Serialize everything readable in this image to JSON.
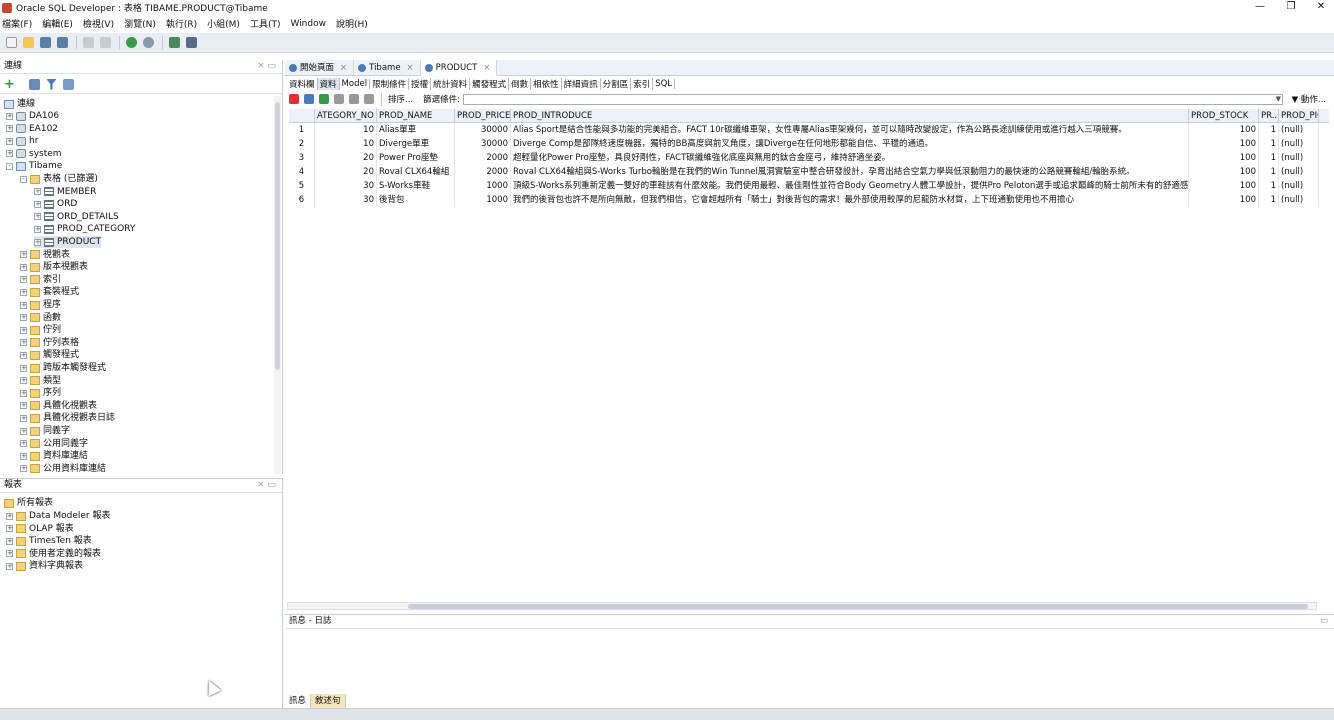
{
  "window": {
    "title": "Oracle SQL Developer : 表格 TIBAME.PRODUCT@Tibame",
    "minimize": "—",
    "maximize": "❐",
    "close": "✕"
  },
  "menu": [
    "檔案(F)",
    "編輯(E)",
    "檢視(V)",
    "瀏覽(N)",
    "執行(R)",
    "小組(M)",
    "工具(T)",
    "Window",
    "說明(H)"
  ],
  "connections": {
    "title": "連線",
    "root": "連線",
    "items": [
      {
        "label": "DA106",
        "level": 1,
        "icon": "db",
        "exp": "+"
      },
      {
        "label": "EA102",
        "level": 1,
        "icon": "db",
        "exp": "+"
      },
      {
        "label": "hr",
        "level": 1,
        "icon": "db",
        "exp": "+"
      },
      {
        "label": "system",
        "level": 1,
        "icon": "db",
        "exp": "+"
      },
      {
        "label": "Tibame",
        "level": 1,
        "icon": "cn",
        "exp": "-"
      },
      {
        "label": "表格 (已篩選)",
        "level": 2,
        "icon": "fld",
        "exp": "-"
      },
      {
        "label": "MEMBER",
        "level": 3,
        "icon": "tbl",
        "exp": "+"
      },
      {
        "label": "ORD",
        "level": 3,
        "icon": "tbl",
        "exp": "+"
      },
      {
        "label": "ORD_DETAILS",
        "level": 3,
        "icon": "tbl",
        "exp": "+"
      },
      {
        "label": "PROD_CATEGORY",
        "level": 3,
        "icon": "tbl",
        "exp": "+"
      },
      {
        "label": "PRODUCT",
        "level": 3,
        "icon": "tbl",
        "exp": "+",
        "selected": true
      },
      {
        "label": "視觀表",
        "level": 2,
        "icon": "fld",
        "exp": "+"
      },
      {
        "label": "版本視觀表",
        "level": 2,
        "icon": "fld",
        "exp": "+"
      },
      {
        "label": "索引",
        "level": 2,
        "icon": "fld",
        "exp": "+"
      },
      {
        "label": "套裝程式",
        "level": 2,
        "icon": "fld",
        "exp": "+"
      },
      {
        "label": "程序",
        "level": 2,
        "icon": "fld",
        "exp": "+"
      },
      {
        "label": "函數",
        "level": 2,
        "icon": "fld",
        "exp": "+"
      },
      {
        "label": "佇列",
        "level": 2,
        "icon": "fld",
        "exp": "+"
      },
      {
        "label": "佇列表格",
        "level": 2,
        "icon": "fld",
        "exp": "+"
      },
      {
        "label": "觸發程式",
        "level": 2,
        "icon": "fld",
        "exp": "+"
      },
      {
        "label": "跨版本觸發程式",
        "level": 2,
        "icon": "fld",
        "exp": "+"
      },
      {
        "label": "類型",
        "level": 2,
        "icon": "fld",
        "exp": "+"
      },
      {
        "label": "序列",
        "level": 2,
        "icon": "fld",
        "exp": "+"
      },
      {
        "label": "具體化視觀表",
        "level": 2,
        "icon": "fld",
        "exp": "+"
      },
      {
        "label": "具體化視觀表日誌",
        "level": 2,
        "icon": "fld",
        "exp": "+"
      },
      {
        "label": "同義字",
        "level": 2,
        "icon": "fld",
        "exp": "+"
      },
      {
        "label": "公用同義字",
        "level": 2,
        "icon": "fld",
        "exp": "+"
      },
      {
        "label": "資料庫連結",
        "level": 2,
        "icon": "fld",
        "exp": "+"
      },
      {
        "label": "公用資料庫連結",
        "level": 2,
        "icon": "fld",
        "exp": "+"
      }
    ]
  },
  "reports": {
    "title": "報表",
    "root": "所有報表",
    "items": [
      "Data Modeler 報表",
      "OLAP 報表",
      "TimesTen 報表",
      "使用者定義的報表",
      "資料字典報表"
    ]
  },
  "doc_tabs": [
    {
      "label": "開始頁面",
      "active": false
    },
    {
      "label": "Tibame",
      "active": false
    },
    {
      "label": "PRODUCT",
      "active": true
    }
  ],
  "sub_tabs": [
    "資料欄",
    "資料",
    "Model",
    "限制條件",
    "授權",
    "統計資料",
    "觸發程式",
    "倒數",
    "相依性",
    "詳細資訊",
    "分割區",
    "索引",
    "SQL"
  ],
  "sub_tab_active": 1,
  "data_toolbar": {
    "sort": "排序...",
    "filter_label": "篩選條件:",
    "filter_value": "",
    "actions": "動作..."
  },
  "grid": {
    "columns": [
      "",
      "ATEGORY_NO",
      "PROD_NAME",
      "PROD_PRICE",
      "PROD_INTRODUCE",
      "PROD_STOCK",
      "PR...",
      "PROD_PIC"
    ],
    "rows": [
      [
        "1",
        "10",
        "Alias單車",
        "30000",
        "Alias Sport是結合性能與多功能的完美組合。FACT 10r碳纖維車架，女性專屬Alias車架幾何，並可以隨時改變設定，作為公路長途訓練使用或進行越入三項競賽。",
        "100",
        "1",
        "(null)"
      ],
      [
        "2",
        "10",
        "Diverge單車",
        "30000",
        "Diverge Comp是部隊終速度機器，獨特的BB高度與前叉角度，讓Diverge在任何地形都能自信、平穩的通過。",
        "100",
        "1",
        "(null)"
      ],
      [
        "3",
        "20",
        "Power Pro座墊",
        "2000",
        "超輕量化Power Pro座墊，具良好剛性，FACT碳纖維強化底座與無用的鈦合金座弓，維持舒適坐姿。",
        "100",
        "1",
        "(null)"
      ],
      [
        "4",
        "20",
        "Roval CLX64輪組",
        "2000",
        "Roval CLX64輪組與S-Works Turbo輪胎是在我們的Win Tunnel風洞實驗室中整合研發設計，孕育出結合空氣力學與低滾動阻力的最快速的公路競賽輪組/輪胎系統。",
        "100",
        "1",
        "(null)"
      ],
      [
        "5",
        "30",
        "S-Works車鞋",
        "1000",
        "頂級S-Works系列重新定義一雙好的車鞋該有什麼效能。我們使用最輕、最佳剛性並符合Body Geometry人體工學設計，提供Pro Peloton選手或追求巔峰的騎士前所未有的舒適感。",
        "100",
        "1",
        "(null)"
      ],
      [
        "6",
        "30",
        "後背包",
        "1000",
        "我們的後背包也許不是所向無敵，但我們相信，它會超越所有「騎士」對後背包的需求！最外部使用較厚的尼龍防水材質，上下班通勤使用也不用擔心",
        "100",
        "1",
        "(null)"
      ]
    ]
  },
  "log_panel": {
    "title": "訊息 - 日誌",
    "tabs": [
      "訊息",
      "敘述句"
    ],
    "active_tab": 1
  }
}
